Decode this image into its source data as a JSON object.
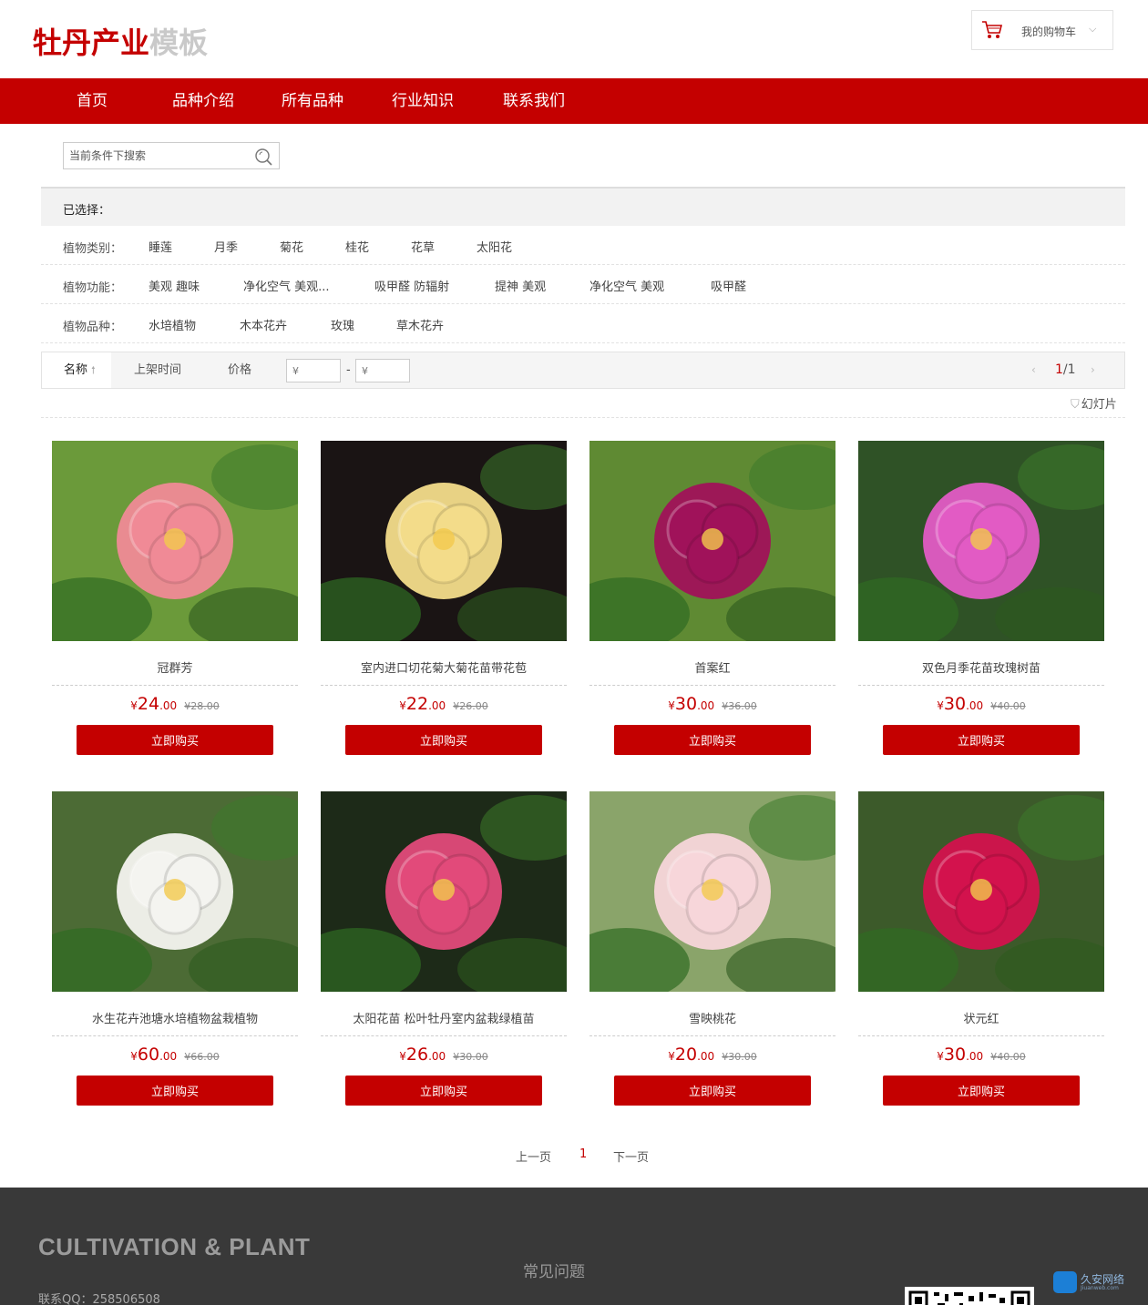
{
  "header": {
    "logo_main": "牡丹产业",
    "logo_sub": "模板",
    "cart_label": "我的购物车"
  },
  "nav": [
    "首页",
    "品种介绍",
    "所有品种",
    "行业知识",
    "联系我们"
  ],
  "search": {
    "placeholder": "当前条件下搜索"
  },
  "filter": {
    "selected_label": "已选择：",
    "rows": [
      {
        "label": "植物类别：",
        "options": [
          "睡莲",
          "月季",
          "菊花",
          "桂花",
          "花草",
          "太阳花"
        ]
      },
      {
        "label": "植物功能：",
        "options": [
          "美观 趣味",
          "净化空气 美观...",
          "吸甲醛 防辐射",
          "提神 美观",
          "净化空气 美观",
          "吸甲醛"
        ]
      },
      {
        "label": "植物品种：",
        "options": [
          "水培植物",
          "木本花卉",
          "玫瑰",
          "草木花卉"
        ]
      }
    ]
  },
  "sortbar": {
    "name": "名称",
    "time": "上架时间",
    "price": "价格",
    "price_from_placeholder": "¥",
    "price_to_placeholder": "¥",
    "dash": "-",
    "page_current": "1",
    "page_total": "/1"
  },
  "slideshow_label": "幻灯片",
  "buy_label": "立即购买",
  "products": [
    {
      "name": "冠群芳",
      "price_int": "24",
      "price_dec": ".00",
      "old_price": "¥28.00",
      "flower_color": "#f08a96",
      "bg": "#6b9a3a"
    },
    {
      "name": "室内进口切花菊大菊花苗带花苞",
      "price_int": "22",
      "price_dec": ".00",
      "old_price": "¥26.00",
      "flower_color": "#f3dc8a",
      "bg": "#1a1414"
    },
    {
      "name": "首案红",
      "price_int": "30",
      "price_dec": ".00",
      "old_price": "¥36.00",
      "flower_color": "#a0125a",
      "bg": "#5f8a33"
    },
    {
      "name": "双色月季花苗玫瑰树苗",
      "price_int": "30",
      "price_dec": ".00",
      "old_price": "¥40.00",
      "flower_color": "#e25bc4",
      "bg": "#2f5226"
    },
    {
      "name": "水生花卉池塘水培植物盆栽植物",
      "price_int": "60",
      "price_dec": ".00",
      "old_price": "¥66.00",
      "flower_color": "#f4f4f0",
      "bg": "#4c6b35"
    },
    {
      "name": "太阳花苗 松叶牡丹室内盆栽绿植苗",
      "price_int": "26",
      "price_dec": ".00",
      "old_price": "¥30.00",
      "flower_color": "#e24a7a",
      "bg": "#1d2a18"
    },
    {
      "name": "雪映桃花",
      "price_int": "20",
      "price_dec": ".00",
      "old_price": "¥30.00",
      "flower_color": "#f7d6da",
      "bg": "#8aa46a"
    },
    {
      "name": "状元红",
      "price_int": "30",
      "price_dec": ".00",
      "old_price": "¥40.00",
      "flower_color": "#d3124d",
      "bg": "#3c5a2a"
    }
  ],
  "currency": "¥",
  "pagination": {
    "prev": "上一页",
    "current": "1",
    "next": "下一页"
  },
  "footer": {
    "title": "CULTIVATION & PLANT",
    "qq": "联系QQ：258506508",
    "faq": "常见问题",
    "watermark": "久安网络",
    "watermark_url": "Jiuanweb.com"
  }
}
